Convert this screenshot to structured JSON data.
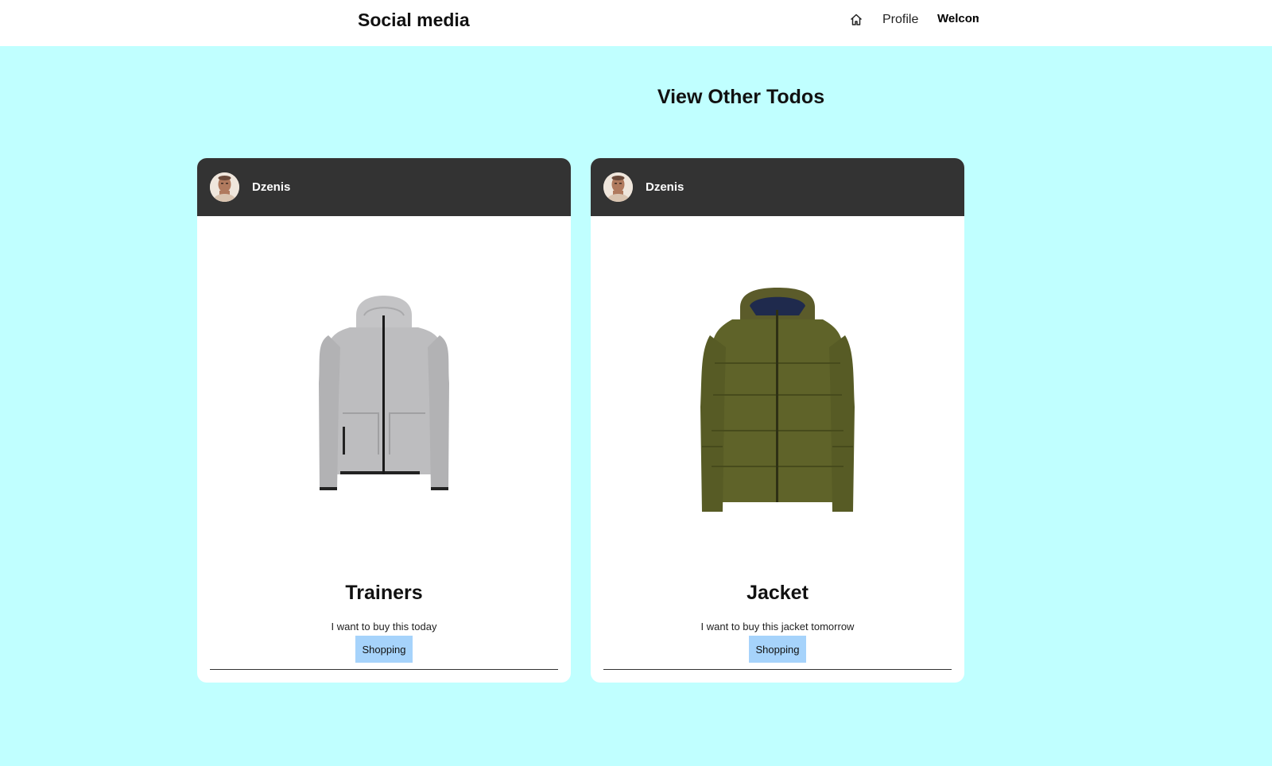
{
  "header": {
    "brand": "Social media",
    "nav": {
      "home_icon": "home-icon",
      "profile_label": "Profile",
      "welcome_text": "Welcome"
    }
  },
  "main": {
    "heading": "View Other Todos",
    "todos": [
      {
        "author": "Dzenis",
        "avatar_icon": "avatar",
        "image": "grey zip hoodie",
        "title": "Trainers",
        "description": "I want to buy this today",
        "tag": "Shopping"
      },
      {
        "author": "Dzenis",
        "avatar_icon": "avatar",
        "image": "olive puffer jacket",
        "title": "Jacket",
        "description": "I want to buy this jacket tomorrow",
        "tag": "Shopping"
      }
    ]
  },
  "colors": {
    "page_background": "#c0ffff",
    "card_header": "#333333",
    "tag_background": "#a6d3fb"
  }
}
